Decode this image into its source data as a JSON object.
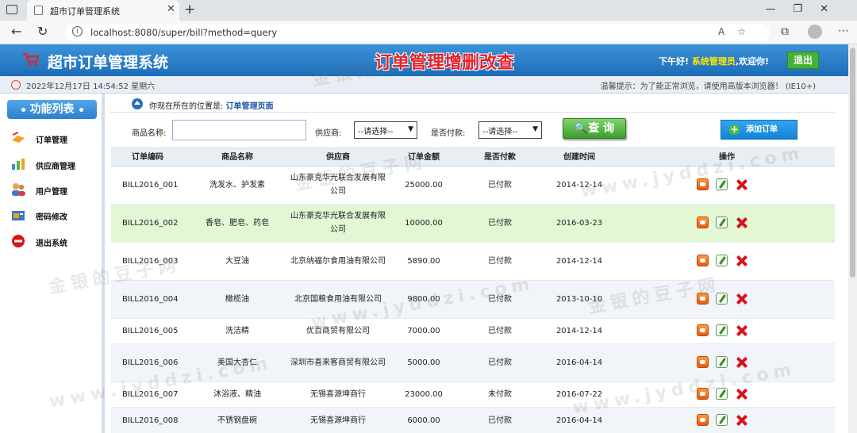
{
  "browser": {
    "tab_title": "超市订单管理系统",
    "url": "localhost:8080/super/bill?method=query"
  },
  "header": {
    "system_name": "超市订单管理系统",
    "page_title": "订单管理增删改查",
    "greeting_prefix": "下午好!",
    "user": "系统管理员",
    "greeting_suffix": ",欢迎你!",
    "logout_label": "退出"
  },
  "strip": {
    "datetime": "2022年12月17日 14:54:52 星期六",
    "tip": "温馨提示：为了能正常浏览，请使用高版本浏览器！ (IE10+)"
  },
  "sidebar": {
    "title": "功能列表",
    "items": [
      {
        "label": "订单管理",
        "icon": "order-icon"
      },
      {
        "label": "供应商管理",
        "icon": "provider-icon"
      },
      {
        "label": "用户管理",
        "icon": "users-icon"
      },
      {
        "label": "密码修改",
        "icon": "password-icon"
      },
      {
        "label": "退出系统",
        "icon": "exit-icon"
      }
    ]
  },
  "breadcrumb": {
    "prefix": "你现在所在的位置是:",
    "current": "订单管理页面"
  },
  "search": {
    "product_label": "商品名称:",
    "product_value": "",
    "provider_label": "供应商:",
    "provider_selected": "--请选择--",
    "paid_label": "是否付款:",
    "paid_selected": "--请选择--",
    "query_label": "查 询",
    "add_label": "添加订单"
  },
  "table": {
    "headers": [
      "订单编码",
      "商品名称",
      "供应商",
      "订单金额",
      "是否付款",
      "创建时间",
      "操作"
    ],
    "rows": [
      {
        "code": "BILL2016_001",
        "product": "洗发水、护发素",
        "provider": "山东豪克华光联合发展有限公司",
        "amount": "25000.00",
        "paid": "已付款",
        "date": "2014-12-14"
      },
      {
        "code": "BILL2016_002",
        "product": "香皂、肥皂、药皂",
        "provider": "山东豪克华光联合发展有限公司",
        "amount": "10000.00",
        "paid": "已付款",
        "date": "2016-03-23"
      },
      {
        "code": "BILL2016_003",
        "product": "大豆油",
        "provider": "北京纳福尔食用油有限公司",
        "amount": "5890.00",
        "paid": "已付款",
        "date": "2014-12-14"
      },
      {
        "code": "BILL2016_004",
        "product": "橄榄油",
        "provider": "北京国粮食用油有限公司",
        "amount": "9800.00",
        "paid": "已付款",
        "date": "2013-10-10"
      },
      {
        "code": "BILL2016_005",
        "product": "洗洁精",
        "provider": "优百商贸有限公司",
        "amount": "7000.00",
        "paid": "已付款",
        "date": "2014-12-14"
      },
      {
        "code": "BILL2016_006",
        "product": "美国大杏仁",
        "provider": "深圳市喜来客商贸有限公司",
        "amount": "5000.00",
        "paid": "已付款",
        "date": "2016-04-14"
      },
      {
        "code": "BILL2016_007",
        "product": "沐浴液、精油",
        "provider": "无锡喜源坤商行",
        "amount": "23000.00",
        "paid": "未付款",
        "date": "2016-07-22"
      },
      {
        "code": "BILL2016_008",
        "product": "不锈钢盘碗",
        "provider": "无锡喜源坤商行",
        "amount": "6000.00",
        "paid": "已付款",
        "date": "2016-04-14"
      }
    ]
  },
  "watermark": {
    "line1": "金银的豆子网",
    "line2": "www.jyddzi.com"
  },
  "colors": {
    "header_blue": "#1d6db8",
    "title_red": "#e8202a",
    "highlight_row": "#e3f7d5",
    "query_green": "#3e9e2d"
  }
}
